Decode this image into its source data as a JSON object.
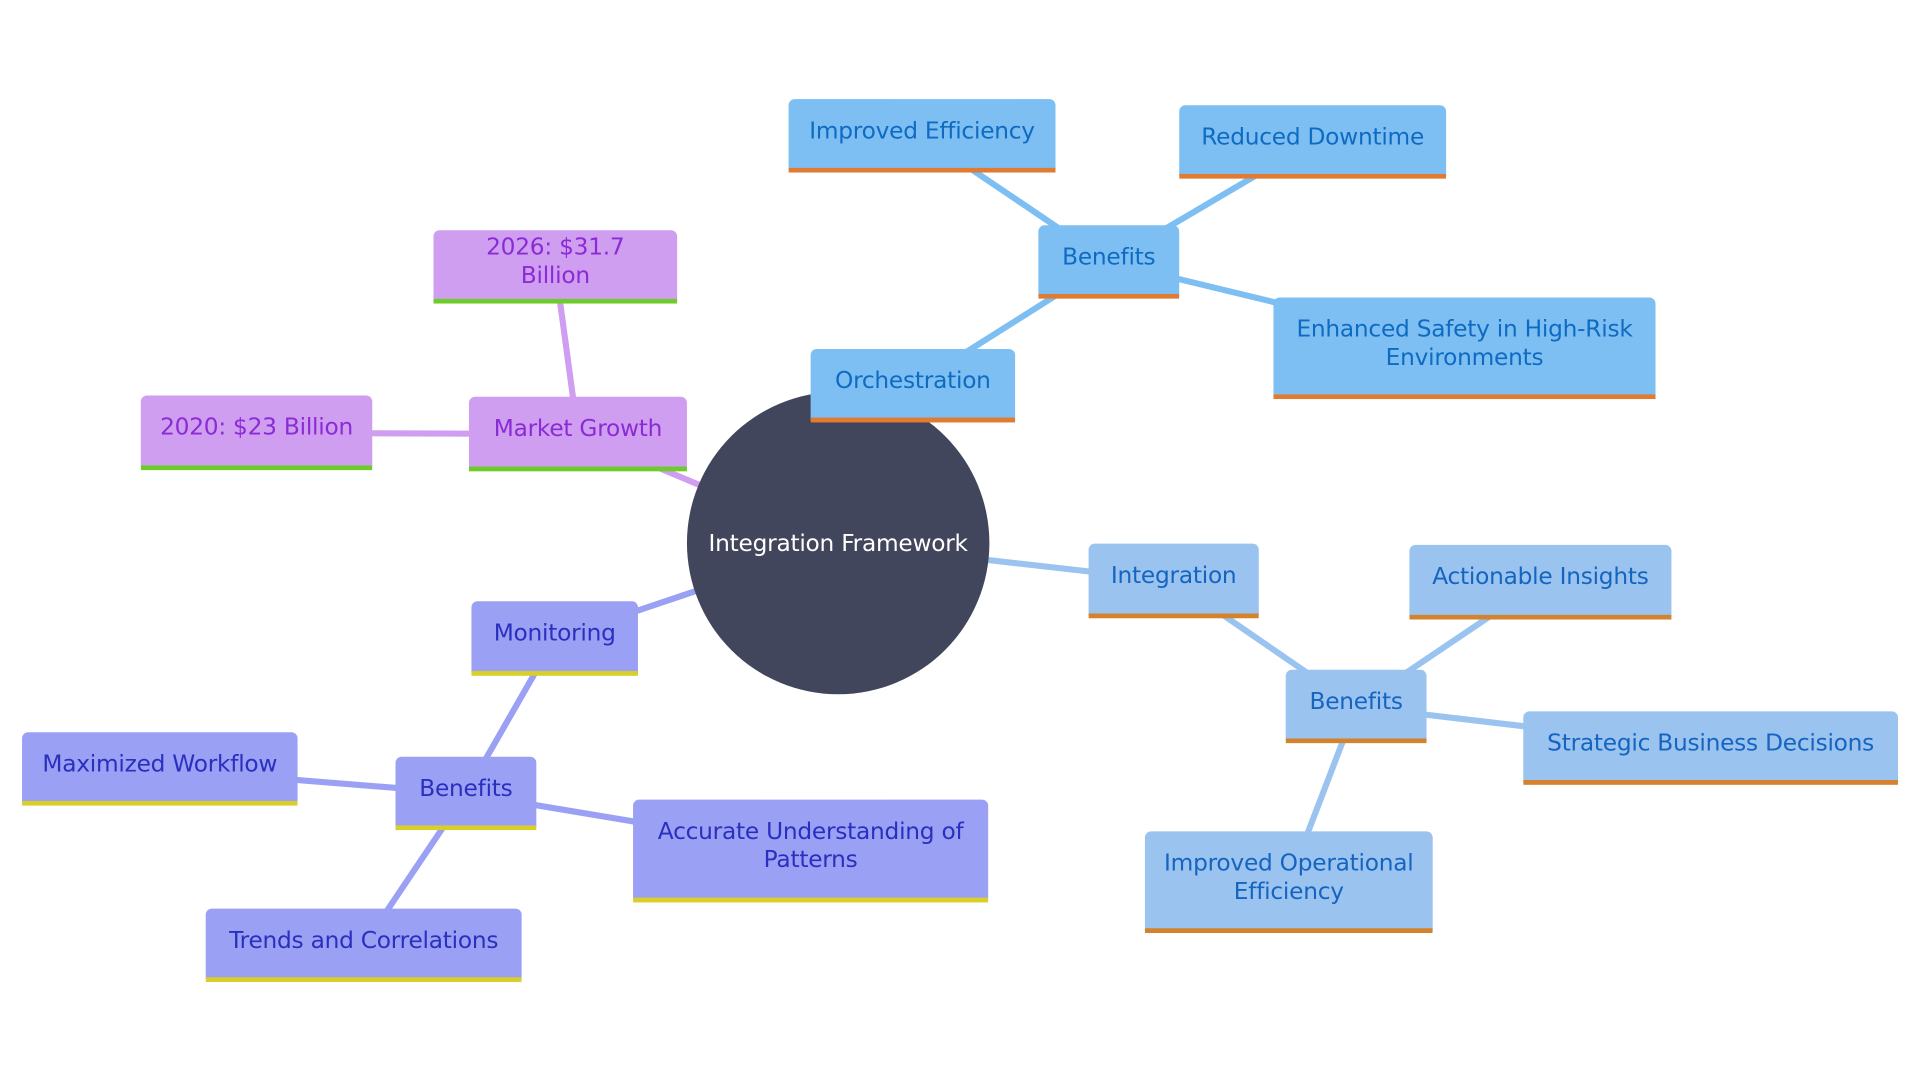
{
  "diagram": {
    "type": "mindmap",
    "root": {
      "id": "root",
      "label": "Integration Framework",
      "color": "#42465C"
    },
    "branches": [
      {
        "id": "orchestration",
        "label": "Orchestration",
        "theme": "b-orch",
        "fill": "#7DBFF2",
        "text": "#0F6BC2",
        "accent": "#E07B31",
        "edge": "#7DBFF2",
        "children": [
          {
            "id": "orch-benefits",
            "label": "Benefits",
            "children": [
              {
                "id": "orch-b1",
                "label": "Improved Efficiency"
              },
              {
                "id": "orch-b2",
                "label": "Reduced Downtime"
              },
              {
                "id": "orch-b3",
                "label": "Enhanced Safety in High-Risk Environments"
              }
            ]
          }
        ]
      },
      {
        "id": "integration",
        "label": "Integration",
        "theme": "b-integ",
        "fill": "#9AC3F0",
        "text": "#1565C0",
        "accent": "#D4822C",
        "edge": "#9AC3F0",
        "children": [
          {
            "id": "integ-benefits",
            "label": "Benefits",
            "children": [
              {
                "id": "integ-b1",
                "label": "Actionable Insights"
              },
              {
                "id": "integ-b2",
                "label": "Strategic Business Decisions"
              },
              {
                "id": "integ-b3",
                "label": "Improved Operational Efficiency"
              }
            ]
          }
        ]
      },
      {
        "id": "monitoring",
        "label": "Monitoring",
        "theme": "b-mon",
        "fill": "#9AA0F3",
        "text": "#2A2FBF",
        "accent": "#D8CF2A",
        "edge": "#9AA0F3",
        "children": [
          {
            "id": "mon-benefits",
            "label": "Benefits",
            "children": [
              {
                "id": "mon-b1",
                "label": "Maximized Workflow"
              },
              {
                "id": "mon-b2",
                "label": "Accurate Understanding of Patterns"
              },
              {
                "id": "mon-b3",
                "label": "Trends and Correlations"
              }
            ]
          }
        ]
      },
      {
        "id": "market-growth",
        "label": "Market Growth",
        "theme": "b-mkt",
        "fill": "#CF9EF0",
        "text": "#8A2BD6",
        "accent": "#6DCC2A",
        "edge": "#CF9EF0",
        "children": [
          {
            "id": "mkt-2026",
            "label": "2026: $31.7 Billion"
          },
          {
            "id": "mkt-2020",
            "label": "2020: $23 Billion"
          }
        ]
      }
    ]
  }
}
